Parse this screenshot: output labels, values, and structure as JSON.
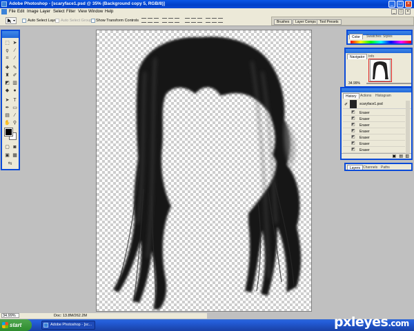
{
  "window": {
    "title": "Adobe Photoshop - [scaryface1.psd @ 35% (Background copy 5, RGB/8)]"
  },
  "menu": [
    "File",
    "Edit",
    "Image",
    "Layer",
    "Select",
    "Filter",
    "View",
    "Window",
    "Help"
  ],
  "options": {
    "auto_select_layer": "Auto Select Layer",
    "auto_select_groups": "Auto Select Groups",
    "show_transform_controls": "Show Transform Controls"
  },
  "well_tabs": [
    "Brushes",
    "Layer Comps",
    "Tool Presets"
  ],
  "toolbox": {
    "icons": [
      "move-tool-icon",
      "marquee-tool-icon",
      "lasso-tool-icon",
      "magic-wand-icon",
      "crop-tool-icon",
      "slice-tool-icon",
      "healing-brush-icon",
      "brush-tool-icon",
      "clone-stamp-icon",
      "history-brush-icon",
      "eraser-tool-icon",
      "gradient-tool-icon",
      "blur-tool-icon",
      "dodge-tool-icon",
      "path-selection-icon",
      "type-tool-icon",
      "pen-tool-icon",
      "shape-tool-icon",
      "notes-tool-icon",
      "eyedropper-icon",
      "hand-tool-icon",
      "zoom-tool-icon"
    ],
    "foreground_color": "#000000",
    "background_color": "#ffffff"
  },
  "status": {
    "zoom": "34.99%",
    "doc": "Doc: 13.8M/262.2M"
  },
  "palettes": {
    "color": {
      "tabs": [
        "Color",
        "Swatches",
        "Styles"
      ]
    },
    "navigator": {
      "tabs": [
        "Navigator",
        "Info"
      ],
      "zoom": "34.99%"
    },
    "history": {
      "tabs": [
        "History",
        "Actions",
        "Histogram"
      ],
      "snapshot": "scaryface1.psd",
      "steps": [
        "Eraser",
        "Eraser",
        "Eraser",
        "Eraser",
        "Eraser",
        "Eraser",
        "Eraser",
        "Eraser"
      ]
    },
    "layers": {
      "tabs": [
        "Layers",
        "Channels",
        "Paths"
      ]
    }
  },
  "taskbar": {
    "start": "start",
    "app_button": "Adobe Photoshop - [sc..."
  },
  "watermark": {
    "name": "pxleyes",
    "domain": ".com"
  }
}
